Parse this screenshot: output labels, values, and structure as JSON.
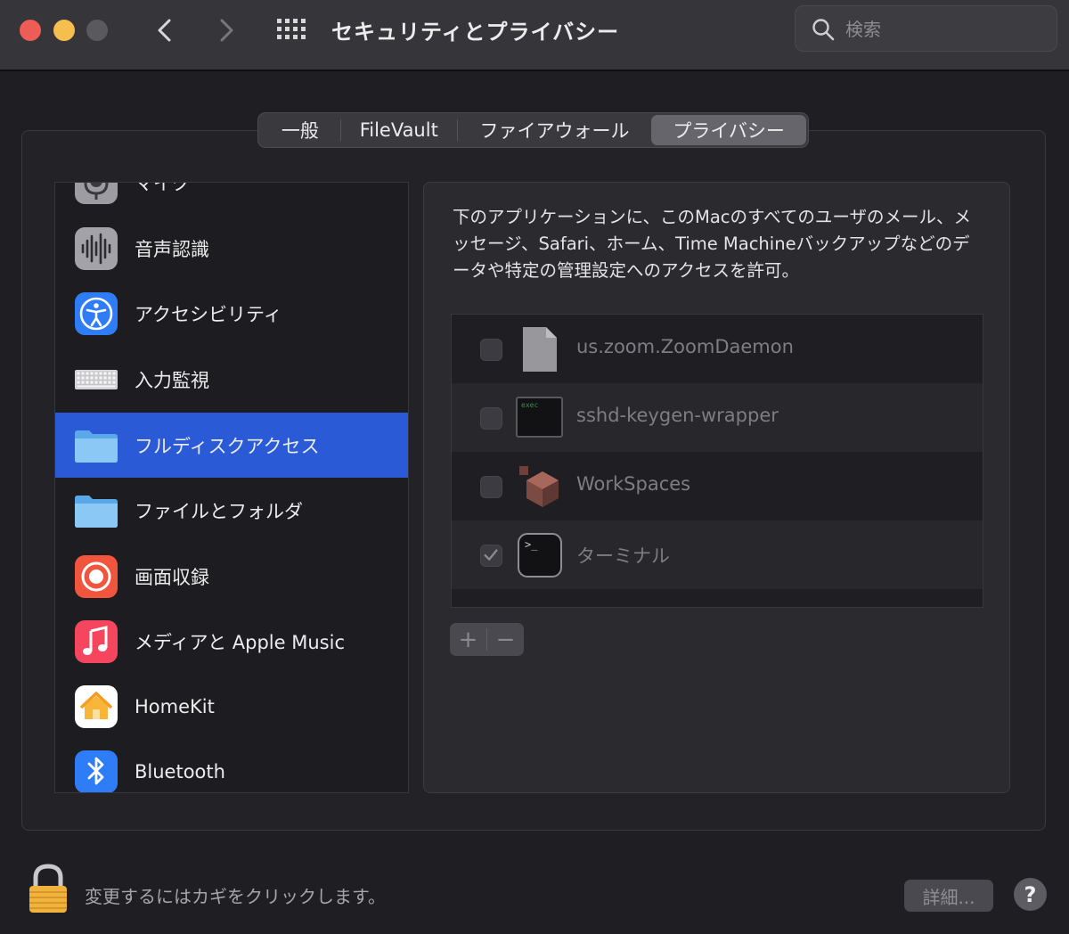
{
  "window": {
    "title": "セキュリティとプライバシー",
    "search_placeholder": "検索"
  },
  "tabs": [
    {
      "label": "一般"
    },
    {
      "label": "FileVault"
    },
    {
      "label": "ファイアウォール"
    },
    {
      "label": "プライバシー",
      "selected": true
    }
  ],
  "categories": [
    {
      "label": "マイク",
      "icon": "microphone-icon"
    },
    {
      "label": "音声認識",
      "icon": "waveform-icon"
    },
    {
      "label": "アクセシビリティ",
      "icon": "accessibility-icon"
    },
    {
      "label": "入力監視",
      "icon": "keyboard-icon"
    },
    {
      "label": "フルディスクアクセス",
      "icon": "folder-icon",
      "selected": true
    },
    {
      "label": "ファイルとフォルダ",
      "icon": "folder-icon"
    },
    {
      "label": "画面収録",
      "icon": "screen-record-icon"
    },
    {
      "label": "メディアと Apple Music",
      "icon": "music-icon"
    },
    {
      "label": "HomeKit",
      "icon": "home-icon"
    },
    {
      "label": "Bluetooth",
      "icon": "bluetooth-icon"
    }
  ],
  "description": "下のアプリケーションに、このMacのすべてのユーザのメール、メッセージ、Safari、ホーム、Time Machineバックアップなどのデータや特定の管理設定へのアクセスを許可。",
  "apps": [
    {
      "name": "us.zoom.ZoomDaemon",
      "checked": false,
      "icon": "document-icon"
    },
    {
      "name": "sshd-keygen-wrapper",
      "checked": false,
      "icon": "exec-icon",
      "icon_label": "exec"
    },
    {
      "name": "WorkSpaces",
      "checked": false,
      "icon": "workspaces-icon"
    },
    {
      "name": "ターミナル",
      "checked": true,
      "icon": "terminal-icon",
      "icon_label": ">_"
    }
  ],
  "buttons": {
    "add": "+",
    "remove": "−",
    "advanced": "詳細...",
    "help": "?"
  },
  "lock_text": "変更するにはカギをクリックします。",
  "colors": {
    "selection": "#2a5ad6",
    "close": "#ee5c56",
    "minimize": "#f5bf4f"
  }
}
